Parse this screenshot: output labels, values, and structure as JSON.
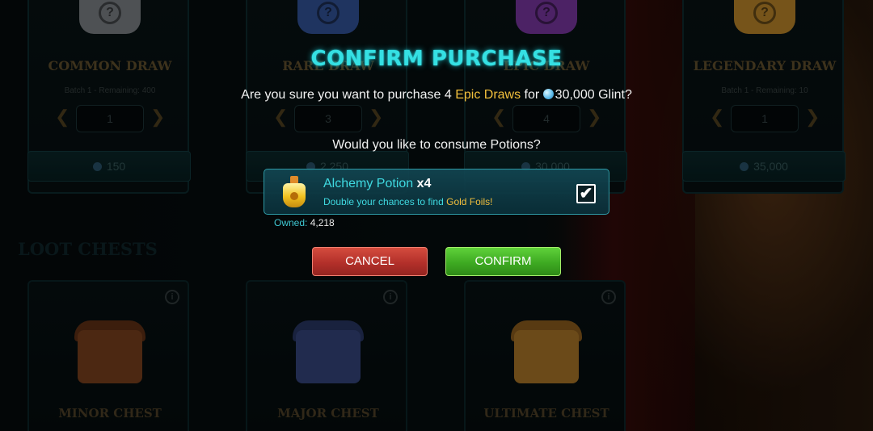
{
  "background": {
    "draws": [
      {
        "title": "COMMON DRAW",
        "batch": "Batch 1 - Remaining: 400",
        "quantity": "1",
        "price": "150",
        "color": "#8e949a"
      },
      {
        "title": "RARE DRAW",
        "batch": "",
        "quantity": "3",
        "price": "2,250",
        "color": "#3a5fb0"
      },
      {
        "title": "EPIC DRAW",
        "batch": "",
        "quantity": "4",
        "price": "30,000",
        "color": "#8a3fb8"
      },
      {
        "title": "LEGENDARY DRAW",
        "batch": "Batch 1 - Remaining: 10",
        "quantity": "1",
        "price": "35,000",
        "color": "#d89a30"
      }
    ],
    "section_title": "LOOT CHESTS",
    "chests": [
      {
        "name": "MINOR CHEST",
        "color": "#8a4a22"
      },
      {
        "name": "MAJOR CHEST",
        "color": "#3c4f8e"
      },
      {
        "name": "ULTIMATE CHEST",
        "color": "#c4882e"
      }
    ]
  },
  "modal": {
    "title": "CONFIRM PURCHASE",
    "question_prefix": "Are you sure you want to purchase 4",
    "question_item": "Epic Draws",
    "question_for": "for",
    "question_amount": "30,000",
    "question_currency": "Glint?",
    "potion_question": "Would you like to consume Potions?",
    "potion": {
      "name": "Alchemy Potion",
      "multiplier": "x4",
      "desc_prefix": "Double your chances to find",
      "desc_highlight": "Gold Foils!",
      "checked": true,
      "check_glyph": "✔",
      "owned_label": "Owned:",
      "owned_value": "4,218"
    },
    "cancel_label": "CANCEL",
    "confirm_label": "CONFIRM"
  },
  "icons": {
    "arrow_left": "❮",
    "arrow_right": "❯",
    "info": "i",
    "question_mark": "?"
  },
  "colors": {
    "title_cyan": "#35e0e3",
    "highlight_gold": "#f2bf3c",
    "cancel_red": "#b3302a",
    "confirm_green": "#3eaa22"
  }
}
